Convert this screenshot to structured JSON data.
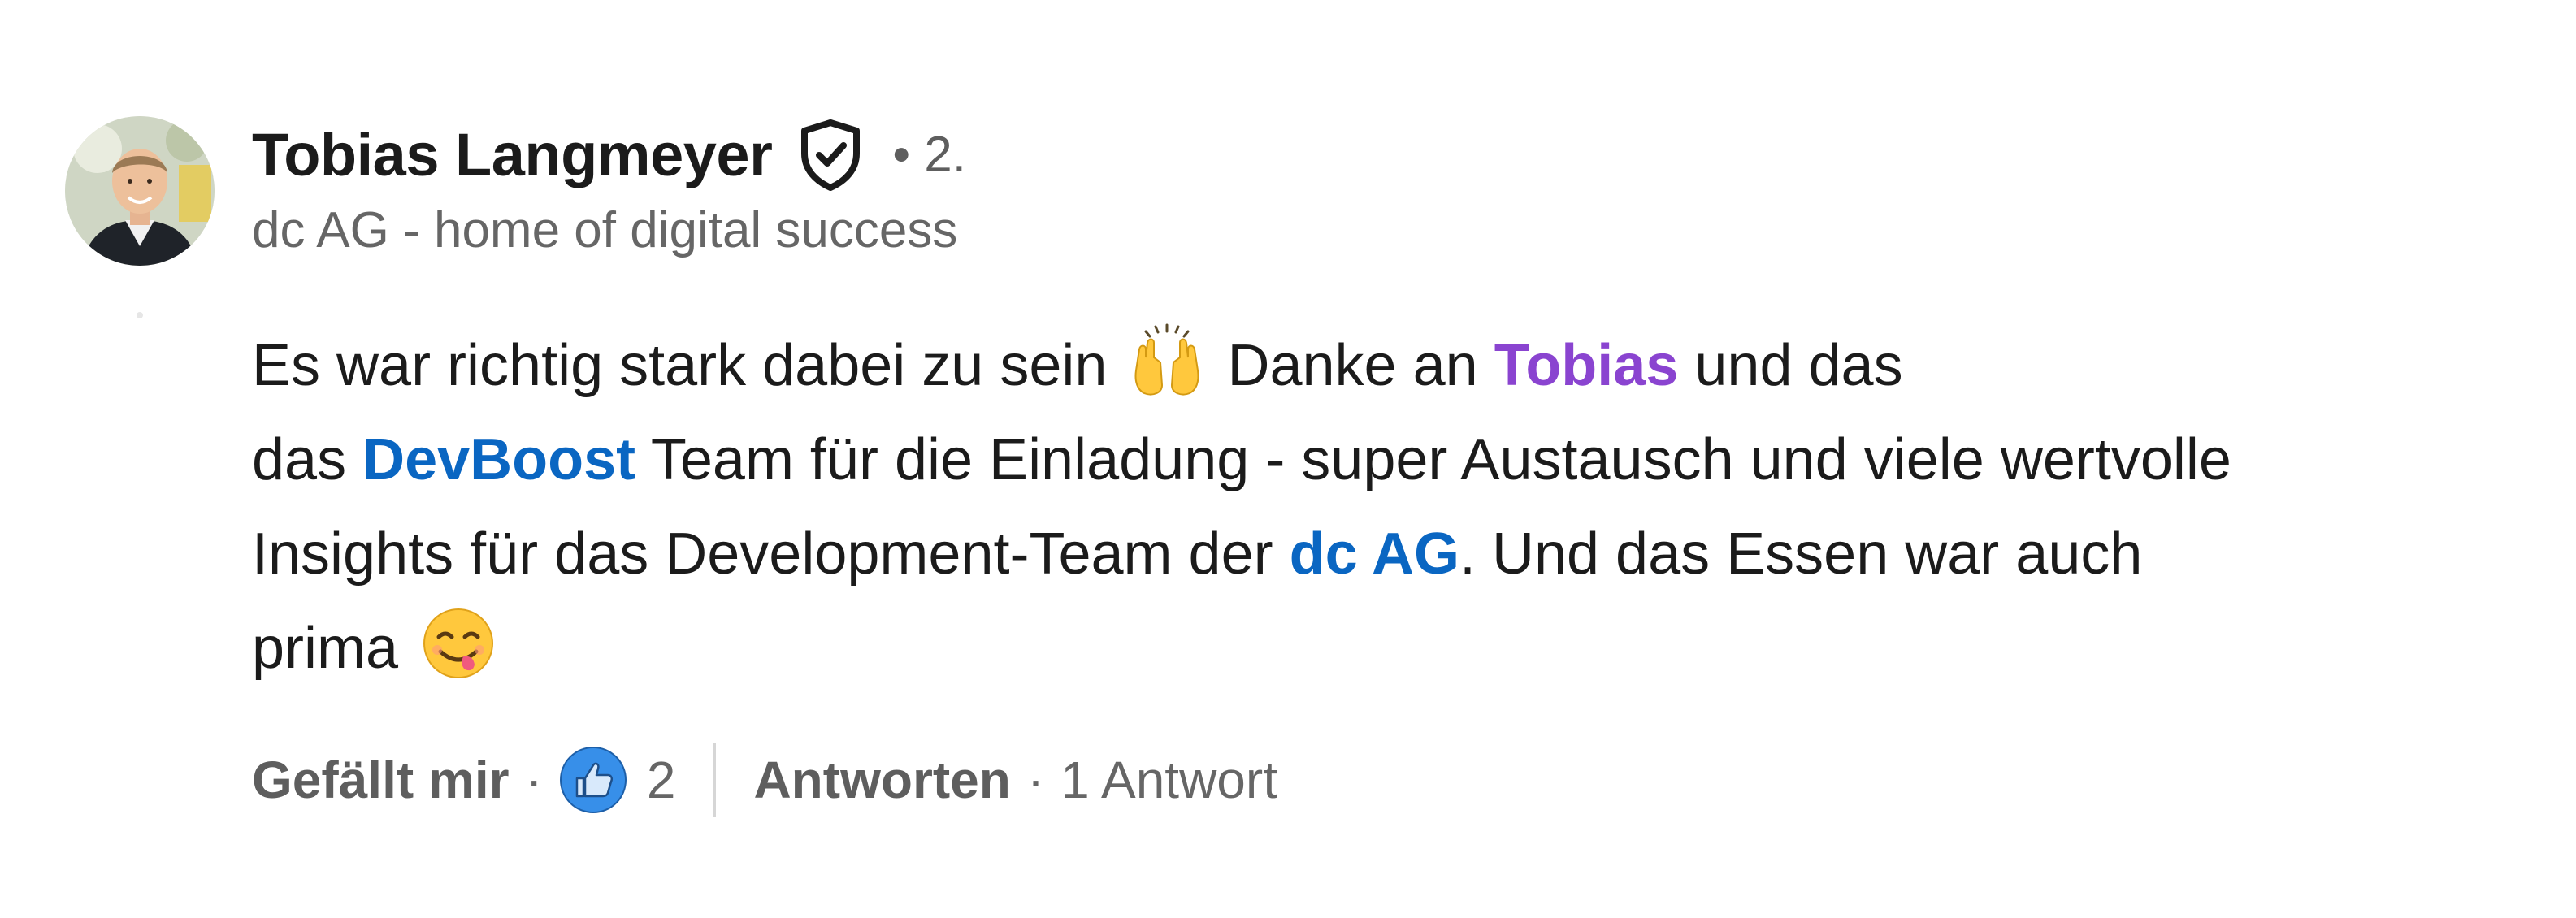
{
  "author": {
    "name": "Tobias Langmeyer",
    "degree": "• 2.",
    "headline": "dc AG - home of digital success",
    "avatar_icon": "profile-photo",
    "badge_icon": "verified-shield-icon"
  },
  "comment": {
    "lines": [
      {
        "parts": [
          {
            "type": "text",
            "value": "Es war richtig stark dabei zu sein "
          },
          {
            "type": "emoji",
            "value": "raising-hands-emoji"
          },
          {
            "type": "text",
            "value": " Danke an "
          },
          {
            "type": "mention_person",
            "value": "Tobias"
          },
          {
            "type": "text",
            "value": " und das"
          }
        ]
      },
      {
        "parts": [
          {
            "type": "text",
            "value": "das "
          },
          {
            "type": "mention_org",
            "value": "DevBoost"
          },
          {
            "type": "text",
            "value": " Team für die Einladung - super Austausch und viele wertvolle"
          }
        ]
      },
      {
        "parts": [
          {
            "type": "text",
            "value": "Insights für das Development-Team der "
          },
          {
            "type": "mention_org",
            "value": "dc AG"
          },
          {
            "type": "text",
            "value": ". Und das Essen war auch"
          }
        ]
      },
      {
        "parts": [
          {
            "type": "text",
            "value": "prima "
          },
          {
            "type": "emoji",
            "value": "yum-face-emoji"
          }
        ]
      }
    ]
  },
  "actions": {
    "like_label": "Gefällt mir",
    "separator": "·",
    "reaction_icon": "like-thumbs-up-icon",
    "reaction_count": "2",
    "reply_label": "Antworten",
    "reply_count": "1 Antwort"
  },
  "colors": {
    "text": "#1b1b1b",
    "secondary_text": "#666666",
    "mention_person": "#8a44d0",
    "mention_org": "#0a66c2",
    "like_blue": "#378fe9"
  }
}
